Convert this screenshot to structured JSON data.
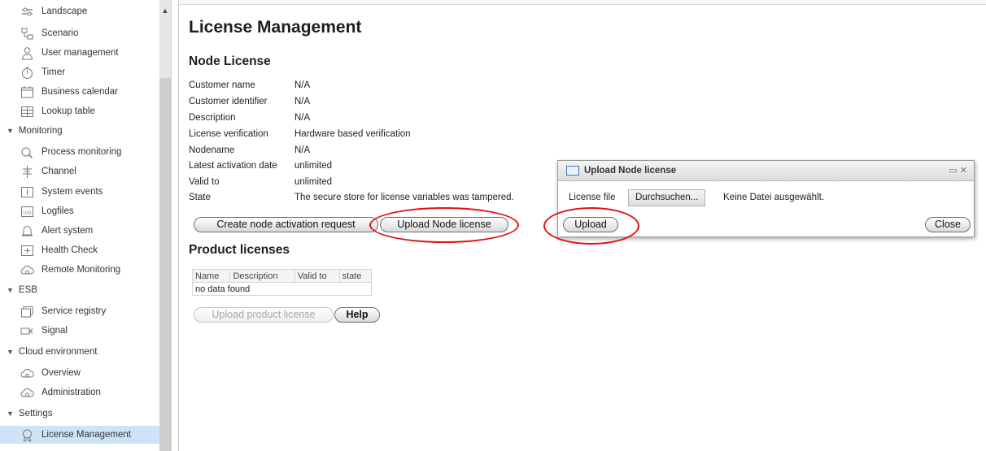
{
  "sidebar": {
    "items": [
      {
        "label": "Landscape",
        "icon": "landscape-icon"
      },
      {
        "label": "Scenario",
        "icon": "scenario-icon"
      },
      {
        "label": "User management",
        "icon": "user-icon"
      },
      {
        "label": "Timer",
        "icon": "timer-icon"
      },
      {
        "label": "Business calendar",
        "icon": "calendar-icon"
      },
      {
        "label": "Lookup table",
        "icon": "table-icon"
      },
      {
        "group": "Monitoring"
      },
      {
        "label": "Process monitoring",
        "icon": "process-monitoring-icon"
      },
      {
        "label": "Channel",
        "icon": "channel-icon"
      },
      {
        "label": "System events",
        "icon": "info-icon"
      },
      {
        "label": "Logfiles",
        "icon": "log-icon"
      },
      {
        "label": "Alert system",
        "icon": "bell-icon"
      },
      {
        "label": "Health Check",
        "icon": "health-check-icon"
      },
      {
        "label": "Remote Monitoring",
        "icon": "cloud-gear-icon"
      },
      {
        "group": "ESB"
      },
      {
        "label": "Service registry",
        "icon": "service-registry-icon"
      },
      {
        "label": "Signal",
        "icon": "signal-icon"
      },
      {
        "group": "Cloud environment"
      },
      {
        "label": "Overview",
        "icon": "cloud-overview-icon"
      },
      {
        "label": "Administration",
        "icon": "cloud-gear-icon"
      },
      {
        "group": "Settings"
      },
      {
        "label": "License Management",
        "icon": "license-icon",
        "selected": true
      }
    ]
  },
  "main": {
    "title": "License Management",
    "node_license": {
      "heading": "Node License",
      "fields": [
        {
          "label": "Customer name",
          "value": "N/A"
        },
        {
          "label": "Customer identifier",
          "value": "N/A"
        },
        {
          "label": "Description",
          "value": "N/A"
        },
        {
          "label": "License verification",
          "value": "Hardware based verification"
        },
        {
          "label": "Nodename",
          "value": "N/A"
        },
        {
          "label": "Latest activation date",
          "value": "unlimited"
        },
        {
          "label": "Valid to",
          "value": "unlimited"
        },
        {
          "label": "State",
          "value": "The secure store for license variables was tampered."
        }
      ],
      "create_request_label": "Create node activation request",
      "upload_label": "Upload Node license"
    },
    "product_licenses": {
      "heading": "Product licenses",
      "columns": [
        "Name",
        "Description",
        "Valid to",
        "state"
      ],
      "empty_text": "no data found",
      "upload_label": "Upload product license",
      "help_label": "Help"
    }
  },
  "dialog": {
    "title": "Upload Node license",
    "controls": "▭ ✕",
    "file_label": "License file",
    "browse_label": "Durchsuchen...",
    "file_status": "Keine Datei ausgewählt.",
    "upload_label": "Upload",
    "close_label": "Close"
  },
  "colors": {
    "annotation": "#e01010",
    "selection": "#cfe3f6"
  }
}
